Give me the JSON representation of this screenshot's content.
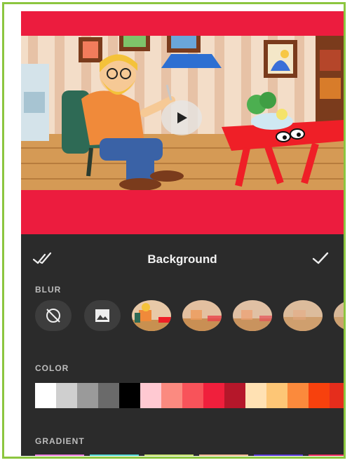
{
  "panel": {
    "title": "Background",
    "blur_label": "BLUR",
    "color_label": "COLOR",
    "gradient_label": "GRADIENT"
  },
  "colors": {
    "accent_red": "#ec1c3e",
    "frame_green": "#8cc63f",
    "panel_bg": "#2b2b2b"
  },
  "icons": {
    "header_left": "double-check-icon",
    "header_right": "check-icon",
    "play": "play-icon",
    "no_blur": "no-blur-icon",
    "image": "image-icon"
  },
  "swatches": [
    "#ffffff",
    "#cfcfcf",
    "#9a9a9a",
    "#6a6a6a",
    "#000000",
    "#ffc9d2",
    "#fb8a80",
    "#f8535a",
    "#f01f3c",
    "#b5172a",
    "#ffe1b3",
    "#fdc676",
    "#fb8a3c",
    "#f7410d",
    "#e52d1c"
  ],
  "gradients": [
    "#e67ad8",
    "#4fd6d0",
    "#c4e06b",
    "#f0b48b",
    "#5b3ad6",
    "#ec2a5c"
  ]
}
